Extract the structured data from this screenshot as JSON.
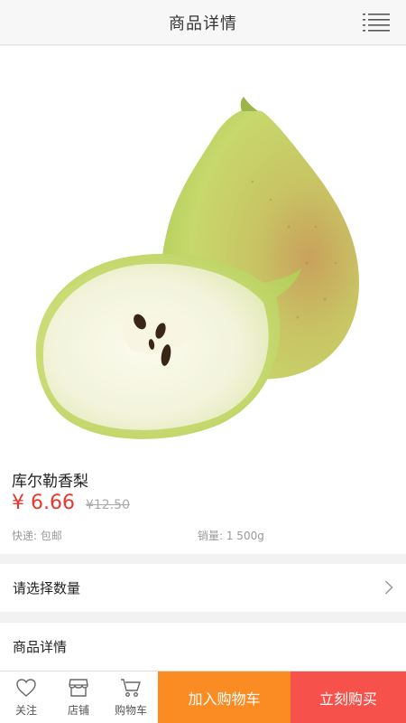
{
  "header": {
    "title": "商品详情",
    "menu_icon": "list-menu-icon"
  },
  "product": {
    "image": "pear-photo",
    "name": "库尔勒香梨",
    "price": "¥ 6.66",
    "original_price": "¥12.50",
    "shipping": "快递: 包邮",
    "sales": "销量: 1 500g"
  },
  "options": {
    "select_quantity_label": "请选择数量"
  },
  "details": {
    "label": "商品详情"
  },
  "bottom_nav": {
    "items": [
      {
        "label": "关注",
        "icon": "heart-icon"
      },
      {
        "label": "店铺",
        "icon": "store-icon"
      },
      {
        "label": "购物车",
        "icon": "cart-icon"
      }
    ],
    "add_to_cart": "加入购物车",
    "buy_now": "立刻购买"
  },
  "colors": {
    "price": "#e8382e",
    "add_to_cart_bg": "#fb8c24",
    "buy_now_bg": "#f6514a"
  }
}
